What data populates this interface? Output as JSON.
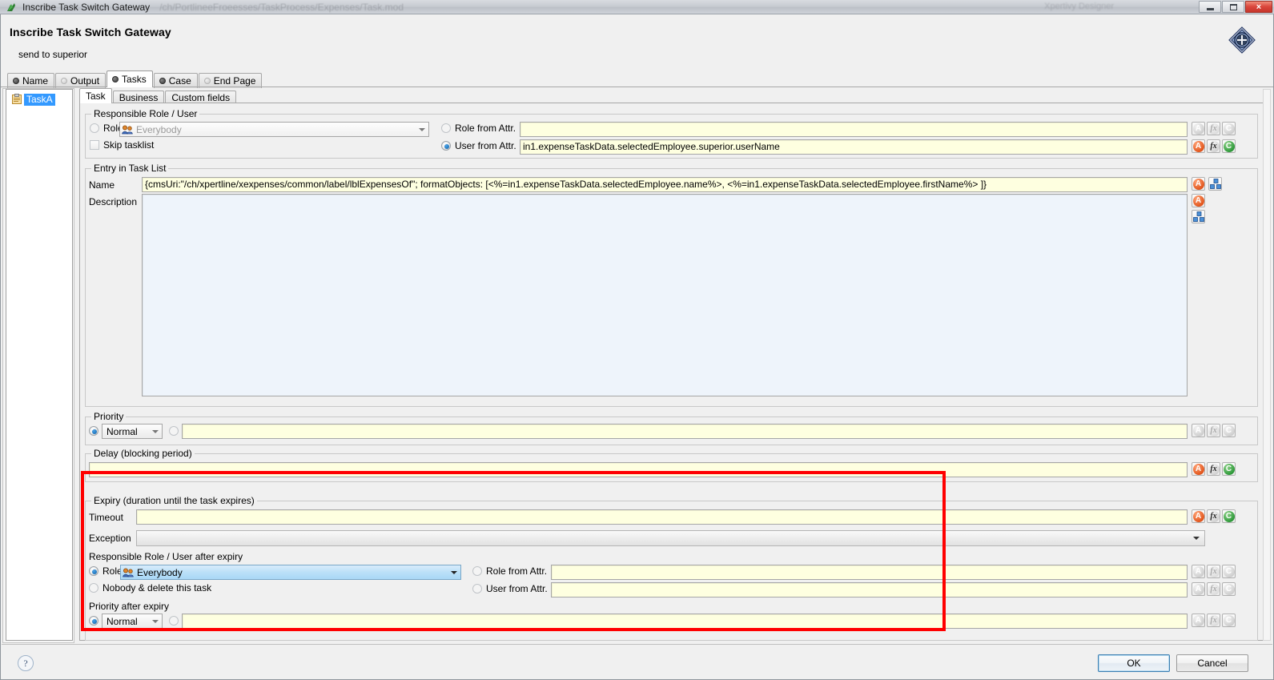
{
  "window": {
    "title": "Inscribe Task Switch Gateway",
    "ghost_path": "/ch/PortlineeFroeesses/TaskProcess/Expenses/Task.mod",
    "ghost_app": "Xpertivy Designer",
    "minimize_label": "Minimize",
    "maximize_label": "Maximize",
    "close_label": "×"
  },
  "header": {
    "title": "Inscribe Task Switch Gateway",
    "subtitle": "send to superior",
    "icon": "task-switch-gateway-icon"
  },
  "outer_tabs": [
    {
      "label": "Name",
      "state": "on",
      "active": false
    },
    {
      "label": "Output",
      "state": "off",
      "active": false
    },
    {
      "label": "Tasks",
      "state": "on",
      "active": true
    },
    {
      "label": "Case",
      "state": "on",
      "active": false
    },
    {
      "label": "End Page",
      "state": "off",
      "active": false
    }
  ],
  "tree": {
    "items": [
      {
        "label": "TaskA",
        "icon": "clipboard-icon",
        "selected": true
      }
    ]
  },
  "inner_tabs": [
    {
      "label": "Task",
      "active": true
    },
    {
      "label": "Business",
      "active": false
    },
    {
      "label": "Custom fields",
      "active": false
    }
  ],
  "responsible": {
    "group_title": "Responsible Role / User",
    "role_label": "Role",
    "role_value": "Everybody",
    "role_icon": "users-group-icon",
    "role_selected": false,
    "skip_tasklist_label": "Skip tasklist",
    "skip_tasklist_checked": false,
    "role_from_attr_label": "Role from Attr.",
    "role_from_attr_selected": false,
    "role_from_attr_value": "",
    "user_from_attr_label": "User from Attr.",
    "user_from_attr_selected": true,
    "user_from_attr_value": "in1.expenseTaskData.selectedEmployee.superior.userName"
  },
  "entry": {
    "group_title": "Entry in Task List",
    "name_label": "Name",
    "name_value": "{cmsUri:\"/ch/xpertline/xexpenses/common/label/lblExpensesOf\"; formatObjects: [<%=in1.expenseTaskData.selectedEmployee.name%>, <%=in1.expenseTaskData.selectedEmployee.firstName%> ]}",
    "description_label": "Description",
    "description_value": ""
  },
  "priority": {
    "group_title": "Priority",
    "radio_fixed_selected": true,
    "value": "Normal",
    "radio_attr_selected": false,
    "attr_value": ""
  },
  "delay": {
    "group_title": "Delay (blocking period)",
    "value": ""
  },
  "expiry": {
    "group_title": "Expiry (duration until the task expires)",
    "timeout_label": "Timeout",
    "timeout_value": "",
    "exception_label": "Exception",
    "exception_value": "",
    "responsible_group_title": "Responsible Role / User after expiry",
    "role_label": "Role",
    "role_value": "Everybody",
    "role_icon": "users-group-icon",
    "role_selected": true,
    "nobody_label": "Nobody & delete this task",
    "nobody_selected": false,
    "role_from_attr_label": "Role from Attr.",
    "role_from_attr_selected": false,
    "role_from_attr_value": "",
    "user_from_attr_label": "User from Attr.",
    "user_from_attr_selected": false,
    "user_from_attr_value": "",
    "priority_group_title": "Priority after expiry",
    "priority_radio_fixed_selected": true,
    "priority_value": "Normal",
    "priority_radio_attr_selected": false,
    "priority_attr_value": ""
  },
  "side_icons": {
    "attribute": "A",
    "function": "fx",
    "cms": "C"
  },
  "footer": {
    "help_label": "?",
    "ok_label": "OK",
    "cancel_label": "Cancel"
  },
  "colors": {
    "highlight_rect": "#ff0000",
    "input_bg": "#feffe0",
    "selection_blue": "#3399ff",
    "accent_orange": "#e2561d",
    "accent_green": "#2f9a3a"
  }
}
